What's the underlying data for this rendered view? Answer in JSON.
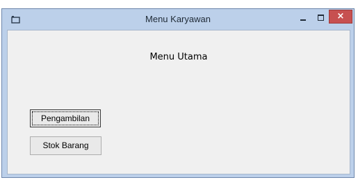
{
  "window": {
    "title": "Menu Karyawan",
    "close_symbol": "×"
  },
  "main": {
    "heading": "Menu Utama",
    "buttons": [
      {
        "label": "Pengambilan",
        "focused": true
      },
      {
        "label": "Stok Barang",
        "focused": false
      }
    ]
  },
  "icons": {
    "app": "application-icon",
    "minimize": "minimize-icon",
    "maximize": "maximize-icon",
    "close": "close-icon"
  },
  "colors": {
    "titlebar": "#bcd0ea",
    "client_background": "#f0f0f0",
    "close_button": "#c75050"
  }
}
